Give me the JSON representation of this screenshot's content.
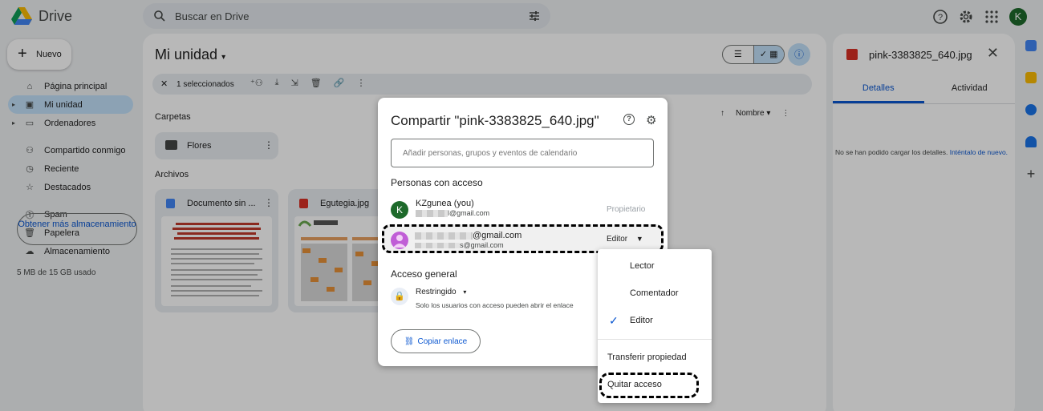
{
  "app": {
    "name": "Drive"
  },
  "search": {
    "placeholder": "Buscar en Drive"
  },
  "new_button": {
    "label": "Nuevo"
  },
  "sidebar": {
    "items": [
      {
        "label": "Página principal"
      },
      {
        "label": "Mi unidad"
      },
      {
        "label": "Ordenadores"
      },
      {
        "label": "Compartido conmigo"
      },
      {
        "label": "Reciente"
      },
      {
        "label": "Destacados"
      },
      {
        "label": "Spam"
      },
      {
        "label": "Papelera"
      },
      {
        "label": "Almacenamiento"
      }
    ],
    "storage_text": "5 MB de 15 GB usado",
    "storage_button": "Obtener más almacenamiento"
  },
  "user": {
    "initial": "K"
  },
  "main": {
    "title": "Mi unidad",
    "selection_count": "1 seleccionados",
    "folders_heading": "Carpetas",
    "folder_name": "Flores",
    "files_heading": "Archivos",
    "files": [
      {
        "name": "Documento sin ..."
      },
      {
        "name": "Egutegia.jpg"
      }
    ],
    "sort_label": "Nombre"
  },
  "details_panel": {
    "filename": "pink-3383825_640.jpg",
    "tabs": [
      "Detalles",
      "Actividad"
    ],
    "error_message": "No se han podido cargar los detalles.",
    "retry_link": "Inténtalo de nuevo."
  },
  "share_dialog": {
    "title": "Compartir \"pink-3383825_640.jpg\"",
    "input_placeholder": "Añadir personas, grupos y eventos de calendario",
    "people_heading": "Personas con acceso",
    "owner": {
      "name": "KZgunea (you)",
      "email_suffix": "l@gmail.com",
      "role": "Propietario",
      "initial": "K"
    },
    "shared_user": {
      "email_suffix": "@gmail.com",
      "email2_suffix": "s@gmail.com",
      "role": "Editor"
    },
    "general_access_heading": "Acceso general",
    "access_mode": "Restringido",
    "access_description": "Solo los usuarios con acceso pueden abrir el enlace",
    "copy_link": "Copiar enlace"
  },
  "role_menu": {
    "items": [
      "Lector",
      "Comentador",
      "Editor"
    ],
    "selected": "Editor",
    "transfer": "Transferir propiedad",
    "remove": "Quitar acceso"
  },
  "colors": {
    "accent": "#0b57d0",
    "selected_bg": "#c2e1fa",
    "owner_avatar": "#1e6a2b",
    "user_avatar": "#c05ed6"
  }
}
